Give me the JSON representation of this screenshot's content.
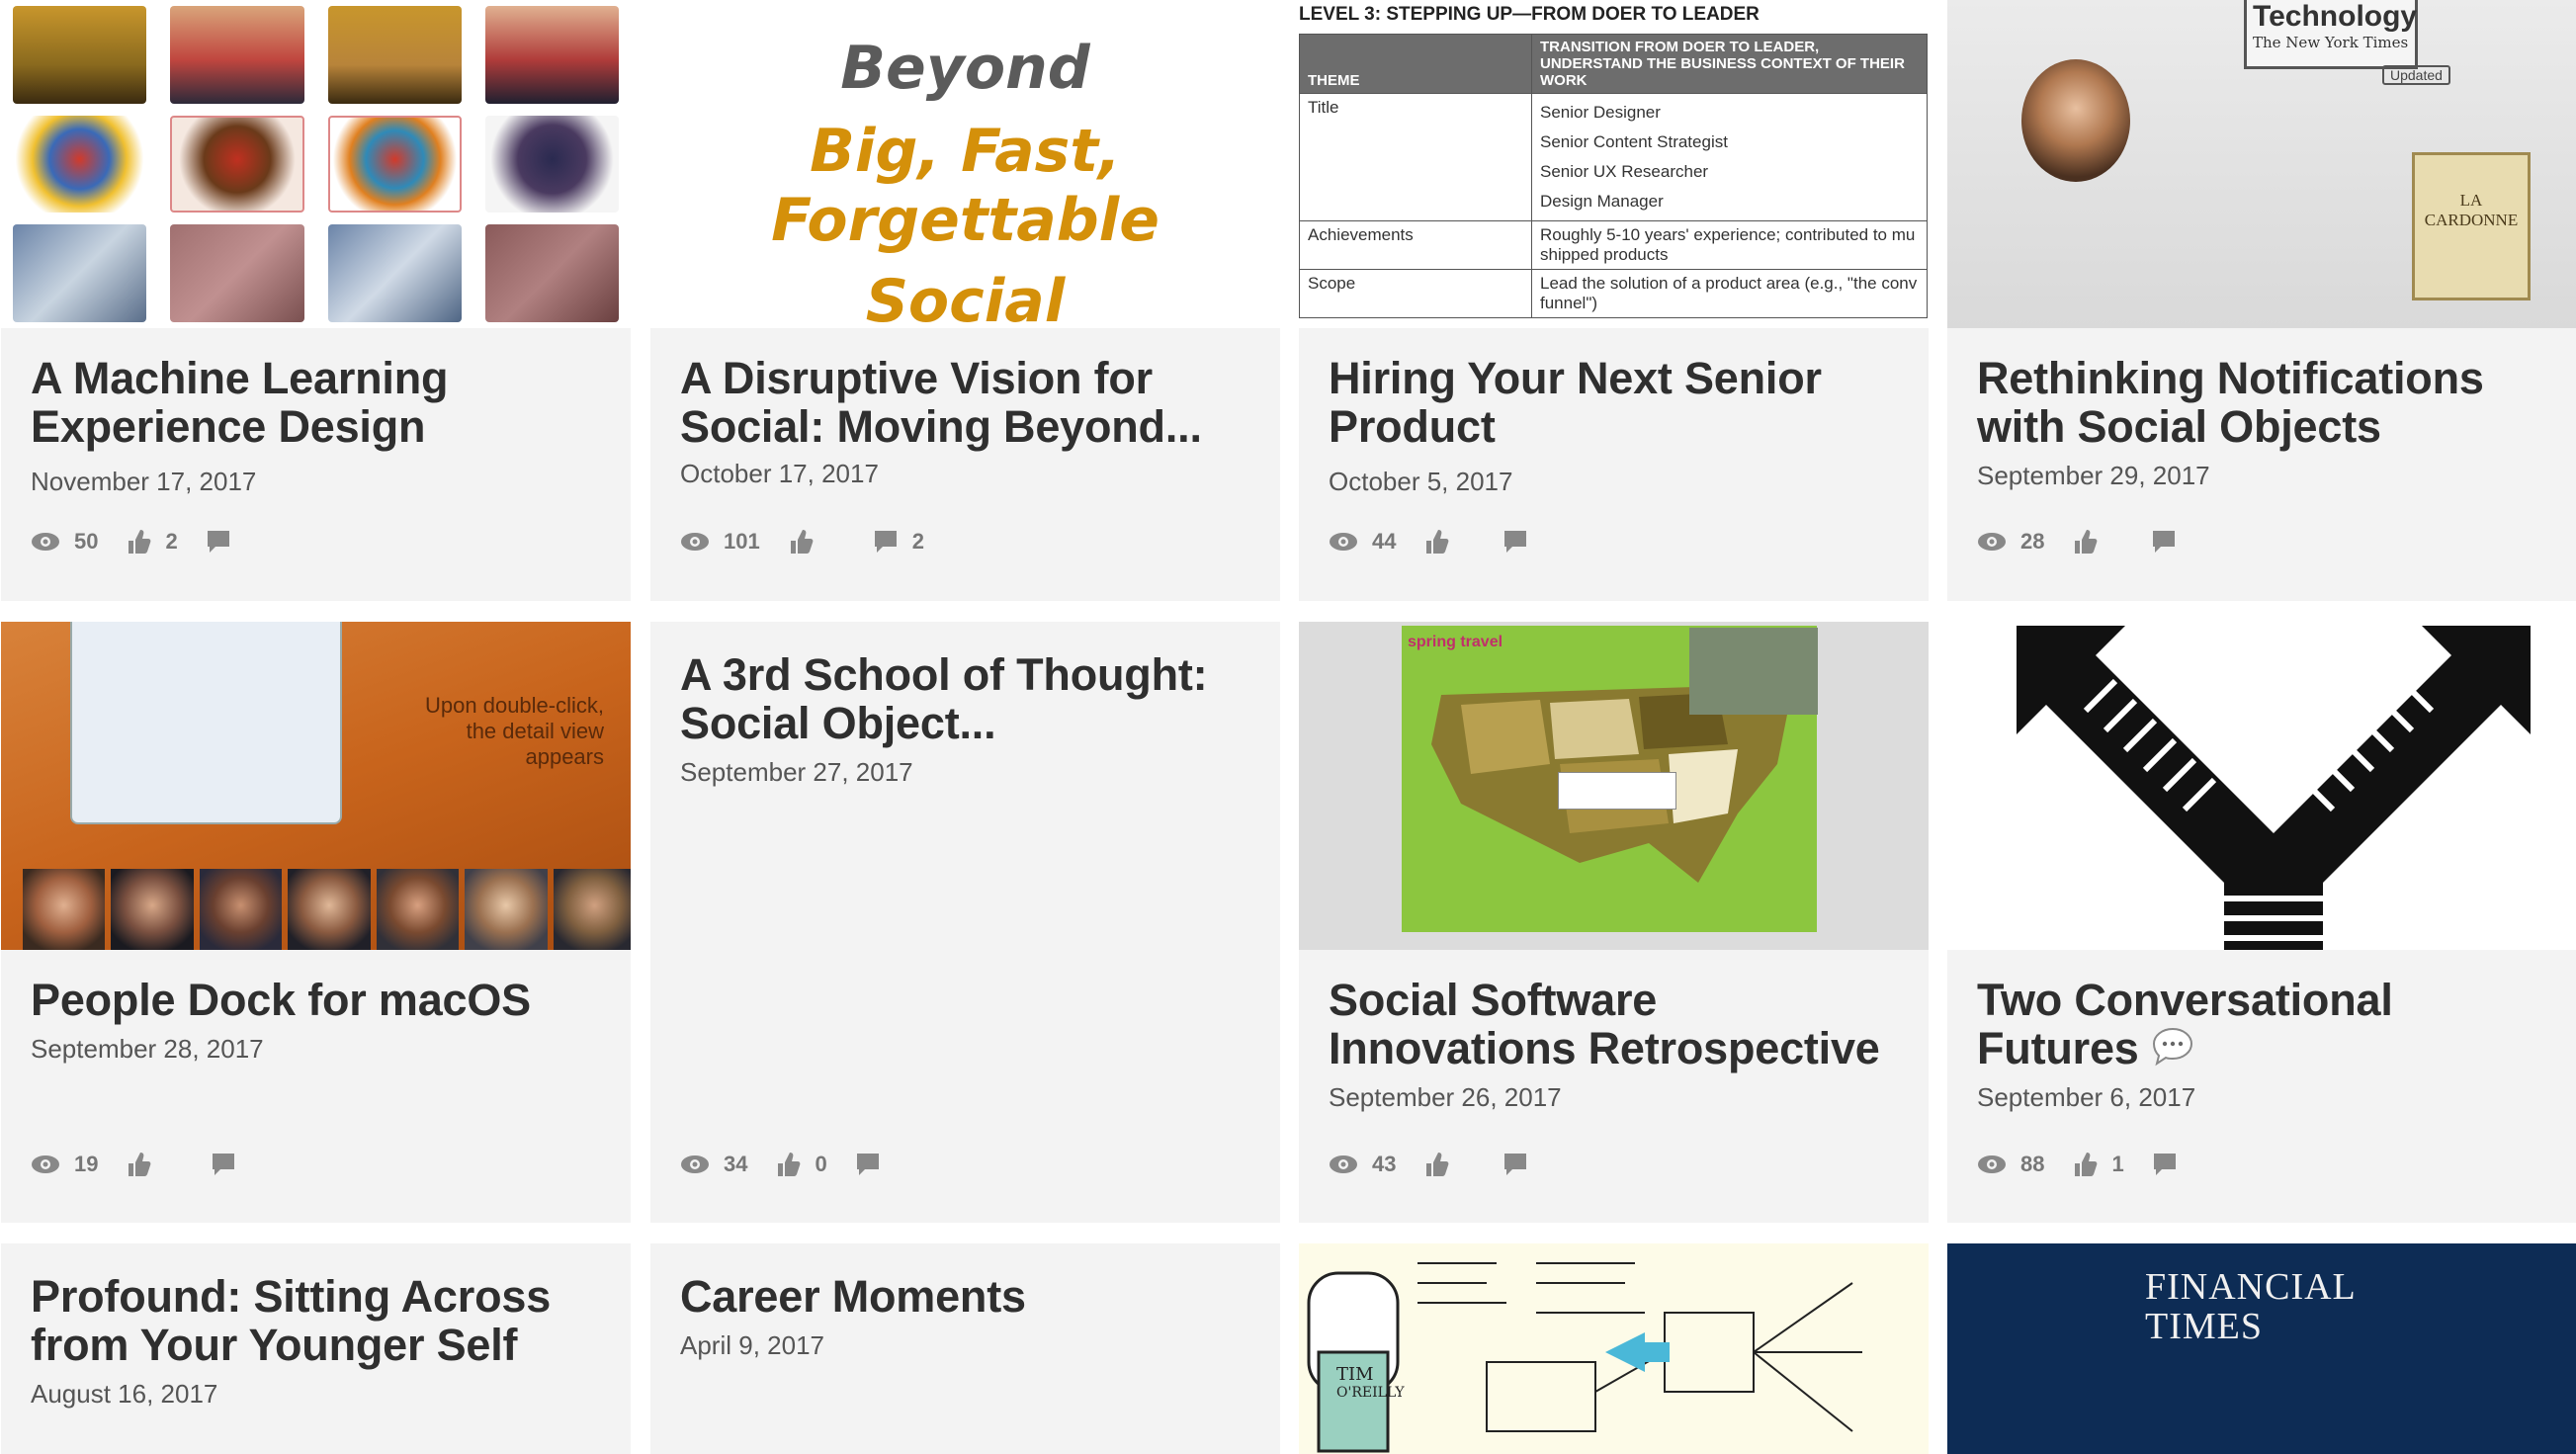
{
  "cards": [
    {
      "title": "A Machine Learning Experience Design",
      "date": "November 17, 2017",
      "views": "50",
      "likes": "2",
      "comments": ""
    },
    {
      "title": "A Disruptive Vision for Social: Moving Beyond...",
      "date": "October 17, 2017",
      "views": "101",
      "likes": "",
      "comments": "2",
      "thumb_lines": [
        "Beyond",
        "Big, Fast, Forgettable",
        "Social"
      ]
    },
    {
      "title": "Hiring Your Next Senior Product",
      "date": "October 5, 2017",
      "views": "44",
      "likes": "",
      "comments": "",
      "thumb_heading": "LEVEL 3: STEPPING UP—FROM DOER TO LEADER",
      "thumb_table": {
        "col1": "THEME",
        "col2": "TRANSITION FROM DOER TO LEADER, UNDERSTAND THE BUSINESS CONTEXT OF THEIR WORK",
        "rows": [
          {
            "k": "Title",
            "v": [
              "Senior Designer",
              "Senior Content Strategist",
              "Senior UX Researcher",
              "Design Manager"
            ]
          },
          {
            "k": "Achievements",
            "v": [
              "Roughly 5-10 years' experience; contributed to mu",
              "shipped products"
            ]
          },
          {
            "k": "Scope",
            "v": [
              "Lead the solution of a product area (e.g., \"the conv",
              "funnel\")"
            ]
          }
        ]
      }
    },
    {
      "title": "Rethinking Notifications with Social Objects",
      "date": "September 29, 2017",
      "views": "28",
      "likes": "",
      "comments": "",
      "thumb_texts": [
        "Technology",
        "The New York Times",
        "Updated",
        "LA CARDONNE"
      ]
    },
    {
      "title": "People Dock for macOS",
      "date": "September 28, 2017",
      "views": "19",
      "likes": "",
      "comments": "",
      "thumb_texts": [
        "Upon double-click,",
        "the detail view appears"
      ]
    },
    {
      "title": "A 3rd School of Thought: Social Object...",
      "date": "September 27, 2017",
      "views": "34",
      "likes": "0",
      "comments": ""
    },
    {
      "title": "Social Software Innovations Retrospective",
      "date": "September 26, 2017",
      "views": "43",
      "likes": "",
      "comments": "",
      "thumb_texts": [
        "spring travel"
      ]
    },
    {
      "title": "Two Conversational Futures",
      "date": "September 6, 2017",
      "views": "88",
      "likes": "1",
      "comments": ""
    },
    {
      "title": "Profound: Sitting Across from Your Younger Self",
      "date": "August 16, 2017"
    },
    {
      "title": "Career Moments",
      "date": "April 9, 2017"
    },
    {
      "title": "",
      "date": "",
      "thumb_texts": [
        "TIM",
        "O'REILLY"
      ]
    },
    {
      "title": "",
      "date": "",
      "thumb_texts": [
        "FINANCIAL",
        "TIMES"
      ]
    }
  ],
  "colors": {
    "card_bg": "#f3f3f3",
    "title": "#2f2f2f",
    "meta": "#777777",
    "ft_blue": "#0d2c55",
    "beyond_gray": "#5b5b5b",
    "beyond_gold": "#d4900a"
  }
}
